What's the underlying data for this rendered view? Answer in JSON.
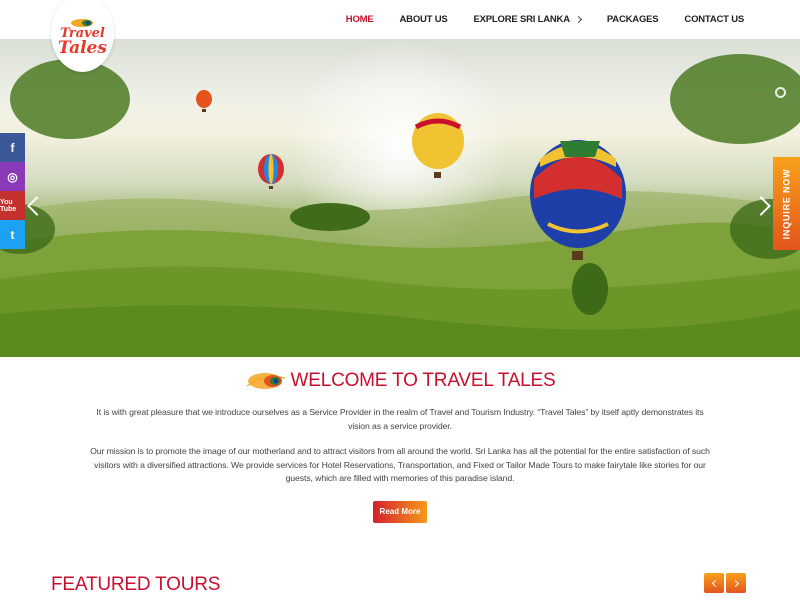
{
  "brand": {
    "line1": "Travel",
    "line2": "Tales",
    "accent": "#c8102e"
  },
  "nav": {
    "home": "HOME",
    "about": "ABOUT US",
    "explore": "EXPLORE SRI LANKA",
    "packages": "PACKAGES",
    "contact": "CONTACT US"
  },
  "social": {
    "facebook": "f",
    "instagram": "◎",
    "youtube": "You Tube",
    "twitter": "t"
  },
  "inquire": "INQUIRE NOW",
  "welcome": {
    "title": "WELCOME TO TRAVEL TALES",
    "p1": "It is with great pleasure that we introduce ourselves as a Service Provider in the realm of Travel and Tourism Industry. “Travel Tales” by itself aptly demonstrates its vision as a service provider.",
    "p2": "Our mission is to promote the image of our motherland and to attract visitors from all around the world. Sri Lanka has all the potential for the entire satisfaction of such visitors with a diversified attractions. We provide services for Hotel Reservations, Transportation, and Fixed or Tailor Made Tours to make fairytale like stories for our guests, which are filled with memories of this paradise island.",
    "read_more": "Read More"
  },
  "featured": {
    "title": "FEATURED TOURS"
  }
}
